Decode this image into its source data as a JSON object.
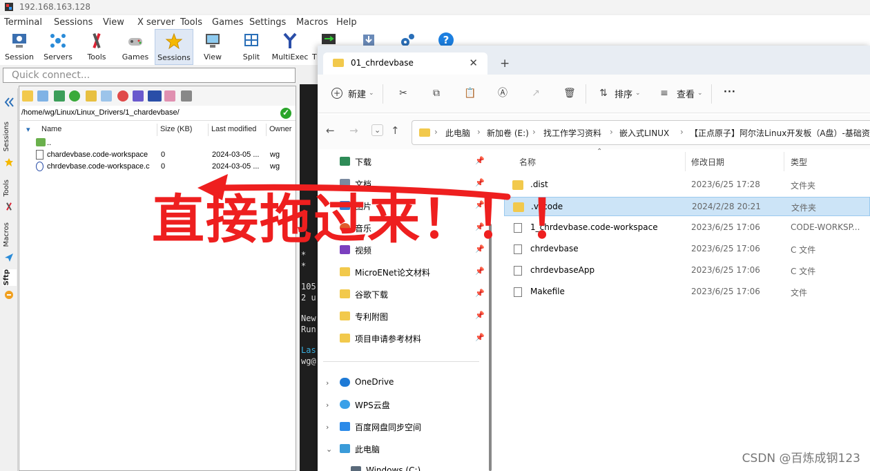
{
  "window": {
    "title": "192.168.163.128"
  },
  "menu": [
    "Terminal",
    "Sessions",
    "View",
    "X server",
    "Tools",
    "Games",
    "Settings",
    "Macros",
    "Help"
  ],
  "toolbar": [
    {
      "label": "Session",
      "icon": "session-icon"
    },
    {
      "label": "Servers",
      "icon": "servers-icon"
    },
    {
      "label": "Tools",
      "icon": "tools-icon"
    },
    {
      "label": "Games",
      "icon": "games-icon"
    },
    {
      "label": "Sessions",
      "icon": "star-icon"
    },
    {
      "label": "View",
      "icon": "view-icon"
    },
    {
      "label": "Split",
      "icon": "split-icon"
    },
    {
      "label": "MultiExec",
      "icon": "multiexec-icon"
    },
    {
      "label": "T",
      "icon": "tunneling-icon"
    }
  ],
  "quick_connect": {
    "placeholder": "Quick connect..."
  },
  "side_tabs": [
    "Sessions",
    "Tools",
    "Macros",
    "Sftp"
  ],
  "sftp": {
    "path": "/home/wg/Linux/Linux_Drivers/1_chardevbase/",
    "columns": {
      "name": "Name",
      "size": "Size (KB)",
      "modified": "Last modified",
      "owner": "Owner"
    },
    "parent": "..",
    "rows": [
      {
        "name": "chardevbase.code-workspace",
        "size": "0",
        "modified": "2024-03-05 ...",
        "owner": "wg"
      },
      {
        "name": "chrdevbase.code-workspace.c",
        "size": "0",
        "modified": "2024-03-05 ...",
        "owner": "wg"
      }
    ]
  },
  "terminal": {
    "lines": [
      "*",
      "*",
      "105",
      "2 u",
      "New",
      "Run",
      "Las",
      "wg@"
    ]
  },
  "explorer": {
    "tab_title": "01_chrdevbase",
    "commands": {
      "new": "新建",
      "sort": "排序",
      "view": "查看",
      "more": "···"
    },
    "breadcrumbs": [
      "此电脑",
      "新加卷 (E:)",
      "找工作学习资料",
      "嵌入式LINUX",
      "【正点原子】阿尔法Linux开发板（A盘）-基础资料"
    ],
    "nav_quick": [
      {
        "label": "下载",
        "icon": "download-icon",
        "color": "#2e8b57"
      },
      {
        "label": "文档",
        "icon": "documents-icon",
        "color": "#7a8aa0"
      },
      {
        "label": "图片",
        "icon": "pictures-icon",
        "color": "#2f7ed8"
      },
      {
        "label": "音乐",
        "icon": "music-icon",
        "color": "#e05a2b"
      },
      {
        "label": "视频",
        "icon": "video-icon",
        "color": "#7b3fbf"
      },
      {
        "label": "MicroENet论文材料",
        "icon": "folder-icon",
        "color": "#f2c94c"
      },
      {
        "label": "谷歌下载",
        "icon": "folder-icon",
        "color": "#f2c94c"
      },
      {
        "label": "专利附图",
        "icon": "folder-icon",
        "color": "#f2c94c"
      },
      {
        "label": "项目申请参考材料",
        "icon": "folder-icon",
        "color": "#f2c94c"
      }
    ],
    "nav_tree": [
      {
        "label": "OneDrive",
        "icon": "onedrive-icon",
        "color": "#1e7ad6",
        "expanded": false
      },
      {
        "label": "WPS云盘",
        "icon": "wps-cloud-icon",
        "color": "#3aa0e8",
        "expanded": false
      },
      {
        "label": "百度网盘同步空间",
        "icon": "baidu-netdisk-icon",
        "color": "#2b8ae8",
        "expanded": false
      },
      {
        "label": "此电脑",
        "icon": "computer-icon",
        "color": "#3a9bd9",
        "expanded": true
      },
      {
        "label": "Windows (C:)",
        "icon": "drive-icon",
        "color": "#5a6a7a",
        "expanded": false
      }
    ],
    "columns": {
      "name": "名称",
      "date": "修改日期",
      "type": "类型"
    },
    "files": [
      {
        "name": ".dist",
        "date": "2023/6/25 17:28",
        "type": "文件夹",
        "kind": "folder",
        "selected": false
      },
      {
        "name": ".vscode",
        "date": "2024/2/28 20:21",
        "type": "文件夹",
        "kind": "folder",
        "selected": true
      },
      {
        "name": "1_chrdevbase.code-workspace",
        "date": "2023/6/25 17:06",
        "type": "CODE-WORKSP...",
        "kind": "doc",
        "selected": false
      },
      {
        "name": "chrdevbase",
        "date": "2023/6/25 17:06",
        "type": "C 文件",
        "kind": "doc",
        "selected": false
      },
      {
        "name": "chrdevbaseApp",
        "date": "2023/6/25 17:06",
        "type": "C 文件",
        "kind": "doc",
        "selected": false
      },
      {
        "name": "Makefile",
        "date": "2023/6/25 17:06",
        "type": "文件",
        "kind": "doc",
        "selected": false
      }
    ]
  },
  "annotation": {
    "text": "直接拖过来！！！",
    "color": "#ee1f1f"
  },
  "watermark": "CSDN @百炼成钢123"
}
